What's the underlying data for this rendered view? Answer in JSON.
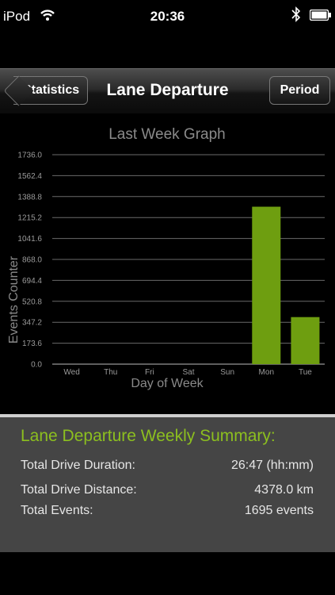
{
  "status": {
    "carrier": "iPod",
    "time": "20:36"
  },
  "nav": {
    "title": "Lane Departure",
    "back_label": "Statistics",
    "period_label": "Period"
  },
  "chart_data": {
    "type": "bar",
    "title": "Last Week Graph",
    "xlabel": "Day of Week",
    "ylabel": "Events Counter",
    "categories": [
      "Wed",
      "Thu",
      "Fri",
      "Sat",
      "Sun",
      "Mon",
      "Tue"
    ],
    "values": [
      0,
      0,
      0,
      0,
      0,
      1305,
      390
    ],
    "yticks": [
      "0.0",
      "173.6",
      "347.2",
      "520.8",
      "694.4",
      "868.0",
      "1041.6",
      "1215.2",
      "1388.8",
      "1562.4",
      "1736.0"
    ],
    "ylim": [
      0,
      1736
    ],
    "grid": true,
    "bar_color": "#6e9e10"
  },
  "summary": {
    "title": "Lane Departure Weekly Summary:",
    "rows": [
      {
        "label": "Total Drive Duration:",
        "value": "26:47 (hh:mm)"
      },
      {
        "label": "Total Drive Distance:",
        "value": "4378.0 km"
      },
      {
        "label": "Total Events:",
        "value": "1695 events"
      }
    ]
  }
}
